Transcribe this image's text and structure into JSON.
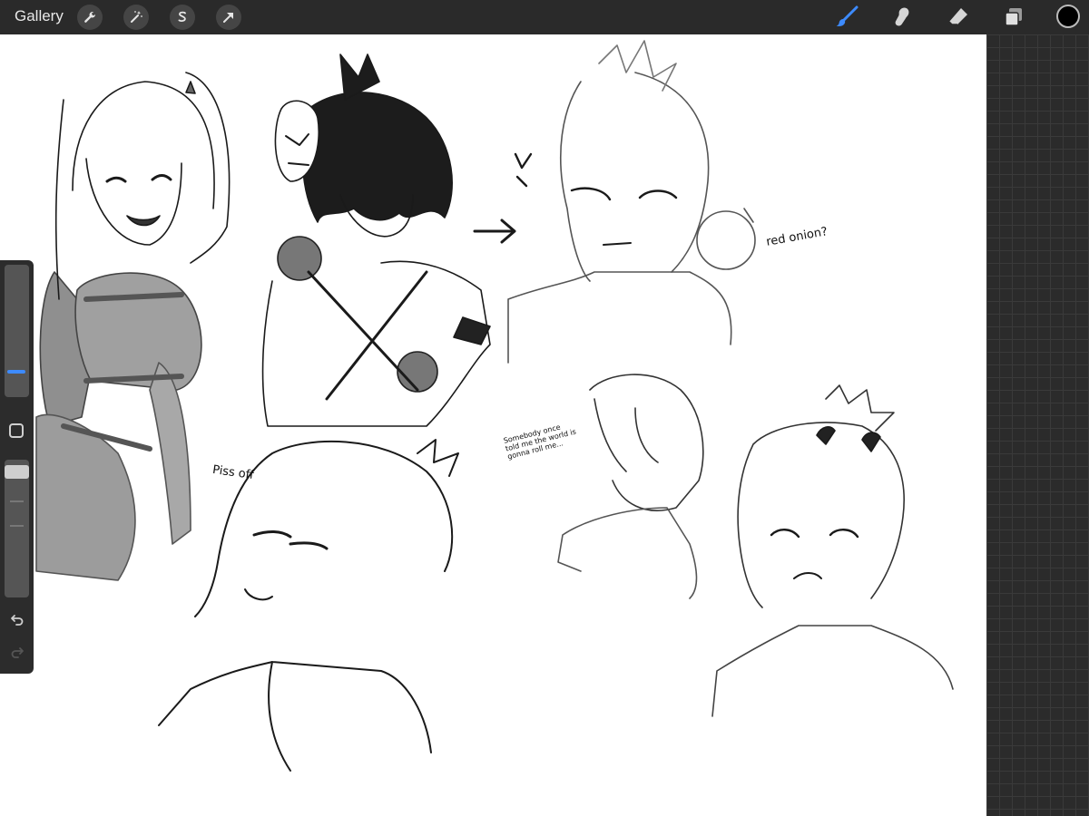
{
  "topbar": {
    "gallery_label": "Gallery",
    "left_tools": [
      "wrench-icon",
      "magic-wand-icon",
      "selection-icon",
      "transform-arrow-icon"
    ],
    "right_tools": [
      "brush-icon",
      "smudge-icon",
      "eraser-icon",
      "layers-icon"
    ],
    "active_tool": "brush-icon",
    "current_color": "#000000",
    "accent_color": "#3d8bff"
  },
  "sidebar": {
    "brush_size": 0.9,
    "brush_opacity": 0.9,
    "controls": [
      "size-slider",
      "modify-button",
      "opacity-slider",
      "undo-icon",
      "redo-icon"
    ]
  },
  "canvas": {
    "notes": {
      "red_onion": "red onion?",
      "piss_off": "Piss off",
      "somebody": "Somebody once told me the world is gonna roll me..."
    }
  }
}
